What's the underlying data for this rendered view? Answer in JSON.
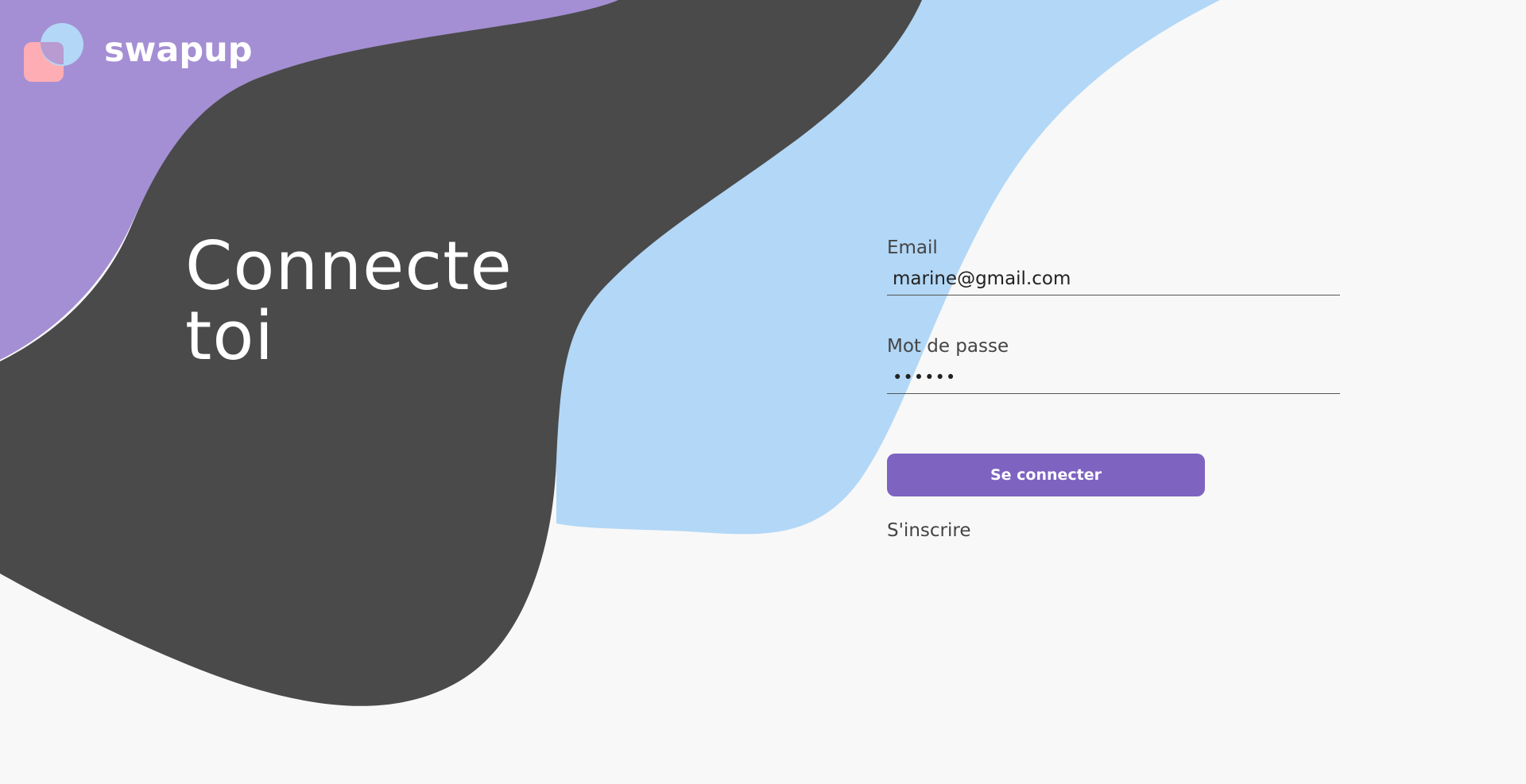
{
  "brand": {
    "name": "swapup",
    "colors": {
      "purple": "#a48fd4",
      "dark": "#4a4a4a",
      "light_blue": "#b3d7f6",
      "pink": "#ffadb4",
      "accent": "#7e63c1",
      "background": "#f8f8f8"
    }
  },
  "hero": {
    "title_line1": "Connecte",
    "title_line2": "toi"
  },
  "form": {
    "email": {
      "label": "Email",
      "value": "marine@gmail.com",
      "placeholder": ""
    },
    "password": {
      "label": "Mot de passe",
      "value": "••••••",
      "placeholder": ""
    },
    "submit_label": "Se connecter",
    "signup_label": "S'inscrire"
  },
  "icons": {
    "logo": "swapup-logo-icon"
  }
}
